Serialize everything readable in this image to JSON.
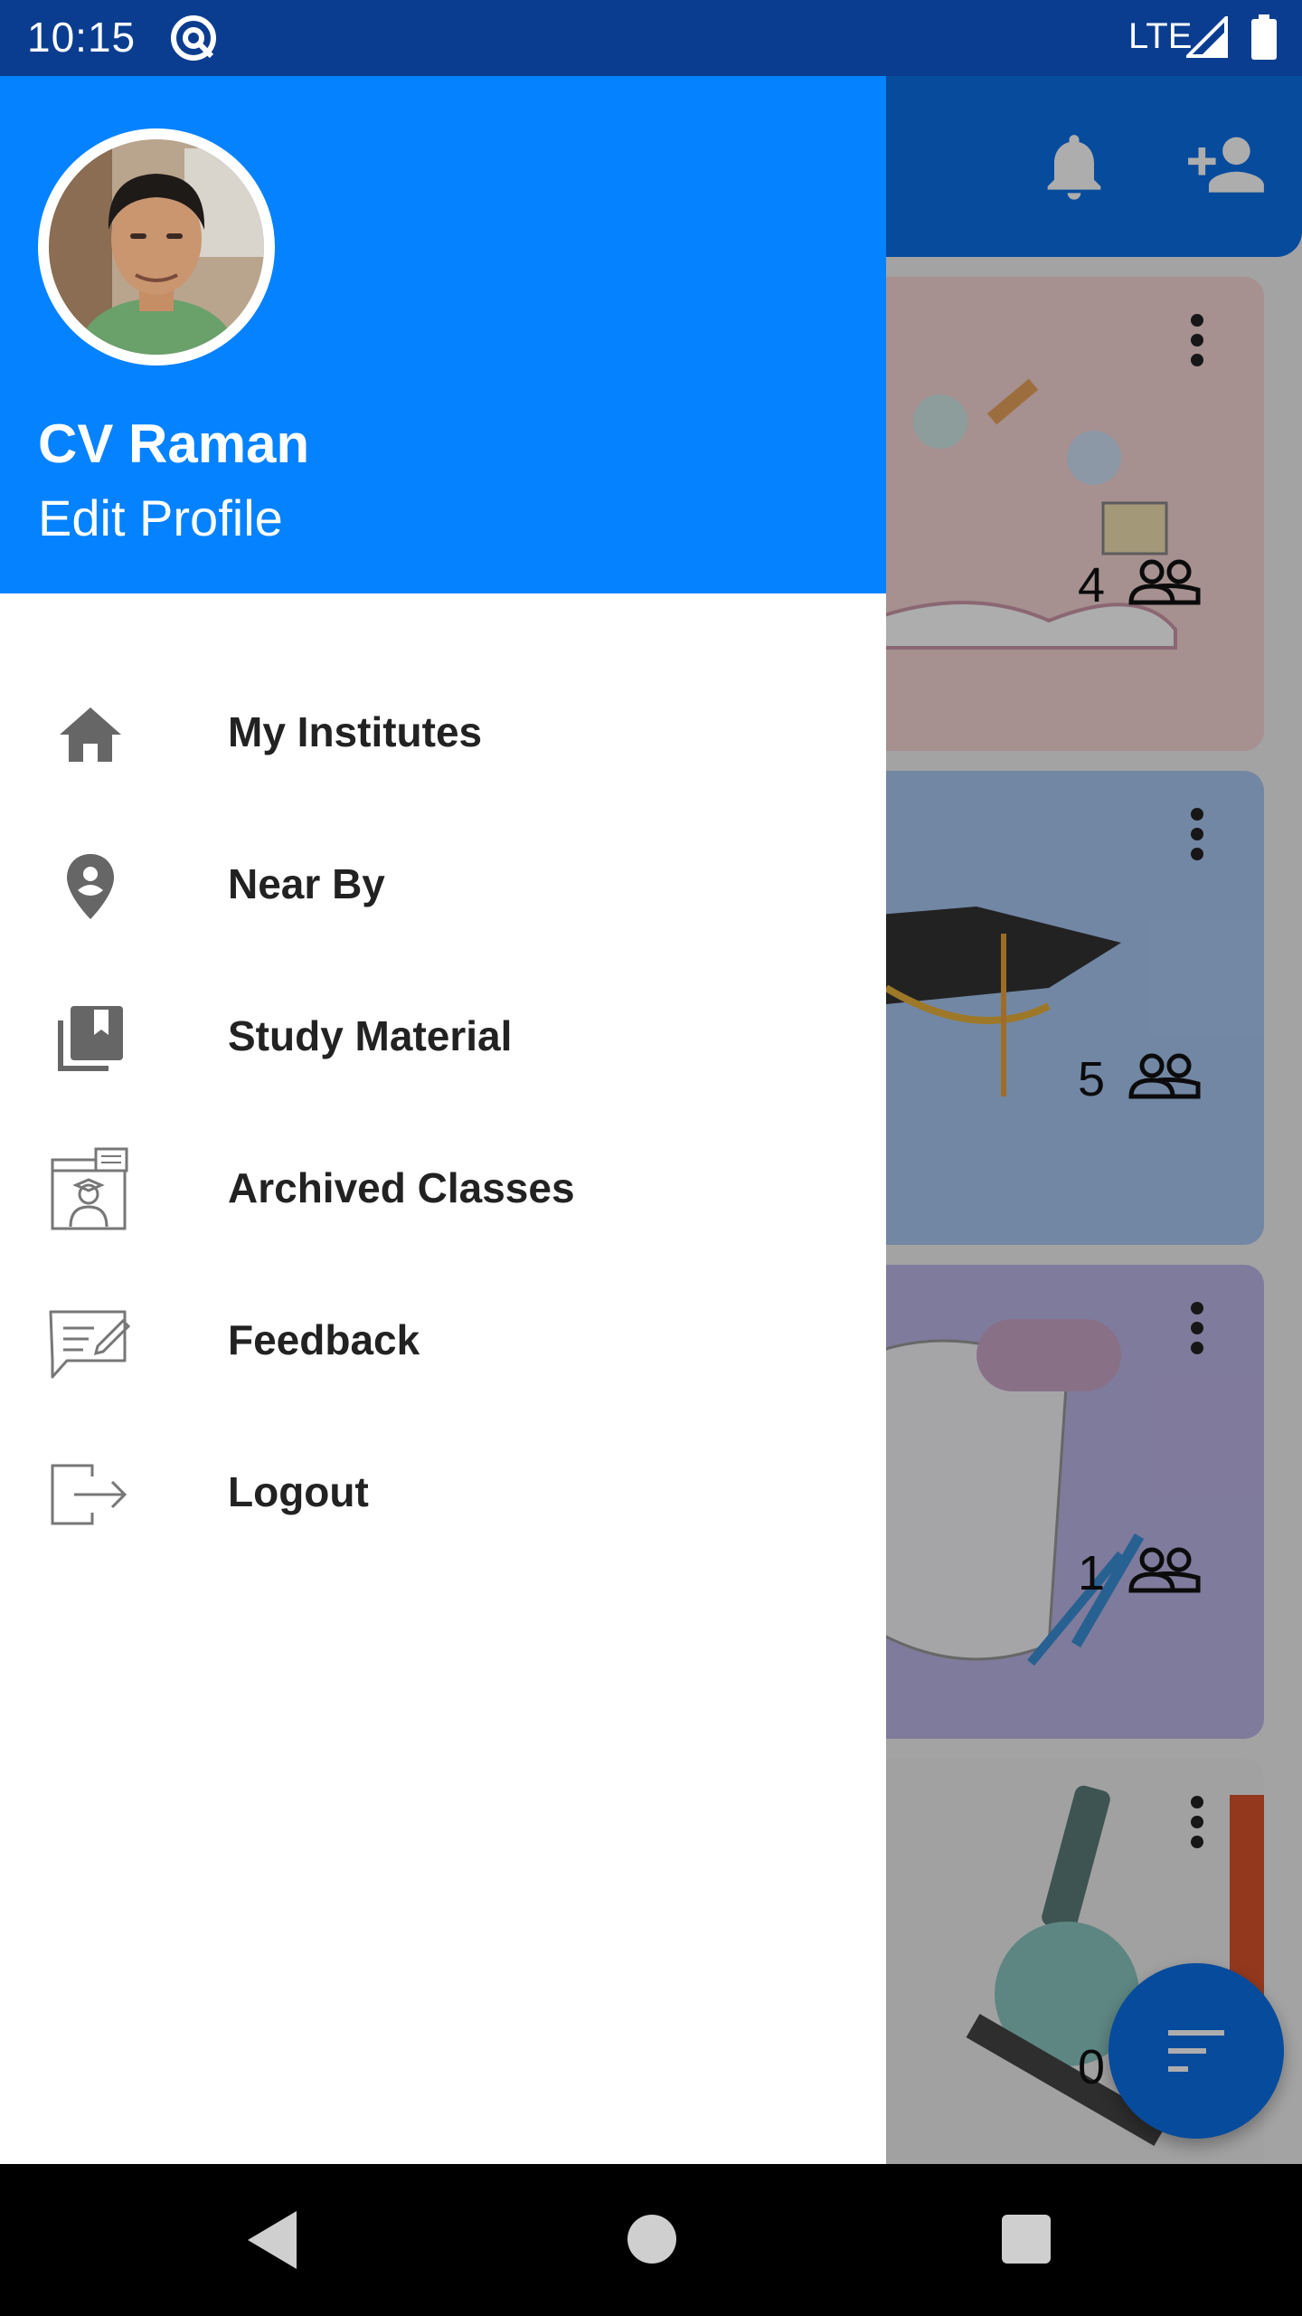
{
  "status_bar": {
    "time": "10:15",
    "network": "LTE",
    "app_icon": "at-sign-icon",
    "background": "#0a3d8f"
  },
  "background_screen": {
    "toolbar_color": "#0a6fe6",
    "icons": [
      "notification-bell-icon",
      "add-person-icon",
      "sort-filter-icon"
    ],
    "cards": [
      {
        "count": "4",
        "color": "#f5d4d4"
      },
      {
        "count": "5",
        "color": "#a9c8f2"
      },
      {
        "count": "1",
        "color": "#bcb5e6"
      },
      {
        "count": "0",
        "color": "#eeeeee"
      }
    ]
  },
  "drawer": {
    "header_color": "#0582ff",
    "user_name": "CV Raman",
    "edit_profile_label": "Edit Profile",
    "items": [
      {
        "label": "My Institutes",
        "icon": "home-icon"
      },
      {
        "label": "Near By",
        "icon": "location-pin-icon"
      },
      {
        "label": "Study Material",
        "icon": "library-books-icon"
      },
      {
        "label": "Archived Classes",
        "icon": "online-class-icon"
      },
      {
        "label": "Feedback",
        "icon": "feedback-icon"
      },
      {
        "label": "Logout",
        "icon": "logout-icon"
      }
    ]
  },
  "nav_bar": {
    "icons": [
      "back-icon",
      "home-circle-icon",
      "recents-icon"
    ]
  }
}
